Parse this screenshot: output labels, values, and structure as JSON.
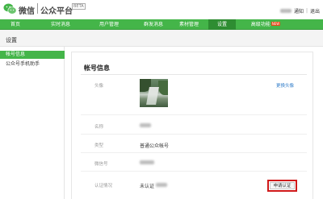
{
  "header": {
    "brand_wechat": "微信",
    "brand_platform": "公众平台",
    "beta": "BETA",
    "user_links": [
      "通知",
      "退出"
    ],
    "user_separator": "|"
  },
  "nav": {
    "items": [
      {
        "label": "首页"
      },
      {
        "label": "实时消息"
      },
      {
        "label": "用户管理"
      },
      {
        "label": "群发消息"
      },
      {
        "label": "素材管理"
      },
      {
        "label": "设置",
        "active": true
      },
      {
        "label": "高级功能",
        "badge": "NEW"
      }
    ]
  },
  "sidebar": {
    "heading": "设置",
    "items": [
      {
        "label": "帐号信息",
        "active": true
      },
      {
        "label": "公众号手机助手"
      }
    ]
  },
  "account": {
    "title": "帐号信息",
    "avatar_label": "头像",
    "change_avatar": "更换头像",
    "name_label": "名称",
    "type_label": "类型",
    "type_value": "普通公众帐号",
    "wechat_id_label": "微信号",
    "verify_label": "认证情况",
    "verify_value": "未认证",
    "apply_button": "申请认证"
  }
}
